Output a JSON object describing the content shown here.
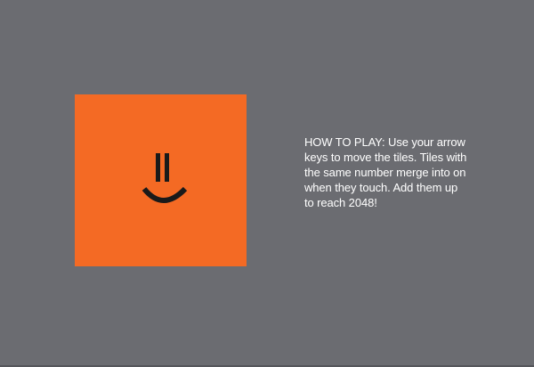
{
  "app": {
    "background_color": "#6b6c71",
    "accent_color": "#f46a24",
    "face_color": "#1a1a1a"
  },
  "logo": {
    "icon": "smiley-face-icon"
  },
  "instructions": {
    "text": "HOW TO PLAY: Use your arrow keys to move the tiles. Tiles with the same number merge into on when they touch. Add them up to reach 2048!"
  }
}
